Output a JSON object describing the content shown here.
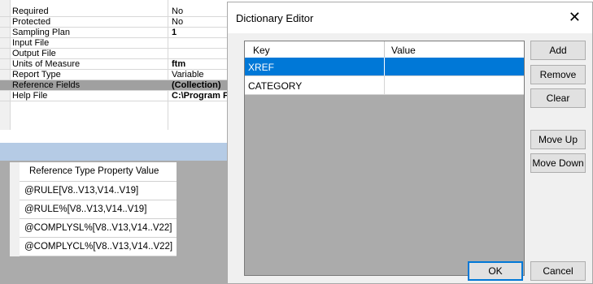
{
  "property_grid": {
    "rows": [
      {
        "name": "Required",
        "value": "No"
      },
      {
        "name": "Protected",
        "value": "No"
      },
      {
        "name": "Sampling Plan",
        "value": "1"
      },
      {
        "name": "Input File",
        "value": ""
      },
      {
        "name": "Output File",
        "value": ""
      },
      {
        "name": "Units of Measure",
        "value": "ftm"
      },
      {
        "name": "Report Type",
        "value": "Variable"
      },
      {
        "name": "Reference Fields",
        "value": "(Collection)"
      },
      {
        "name": "Help File",
        "value": "C:\\Program F"
      }
    ]
  },
  "reference_table": {
    "header": "Reference Type Property Value",
    "rows": [
      "@RULE[V8..V13,V14..V19]",
      "@RULE%[V8..V13,V14..V19]",
      "@COMPLYSL%[V8..V13,V14..V22]",
      "@COMPLYCL%[V8..V13,V14..V22]"
    ]
  },
  "dialog": {
    "title": "Dictionary Editor",
    "close_glyph": "✕",
    "columns": {
      "key": "Key",
      "value": "Value"
    },
    "rows": [
      {
        "key": "XREF",
        "value": ""
      },
      {
        "key": "CATEGORY",
        "value": ""
      }
    ],
    "selected_row": "XREF",
    "buttons": {
      "add": "Add",
      "remove": "Remove",
      "clear": "Clear",
      "move_up": "Move Up",
      "move_down": "Move Down",
      "ok": "OK",
      "cancel": "Cancel"
    }
  }
}
